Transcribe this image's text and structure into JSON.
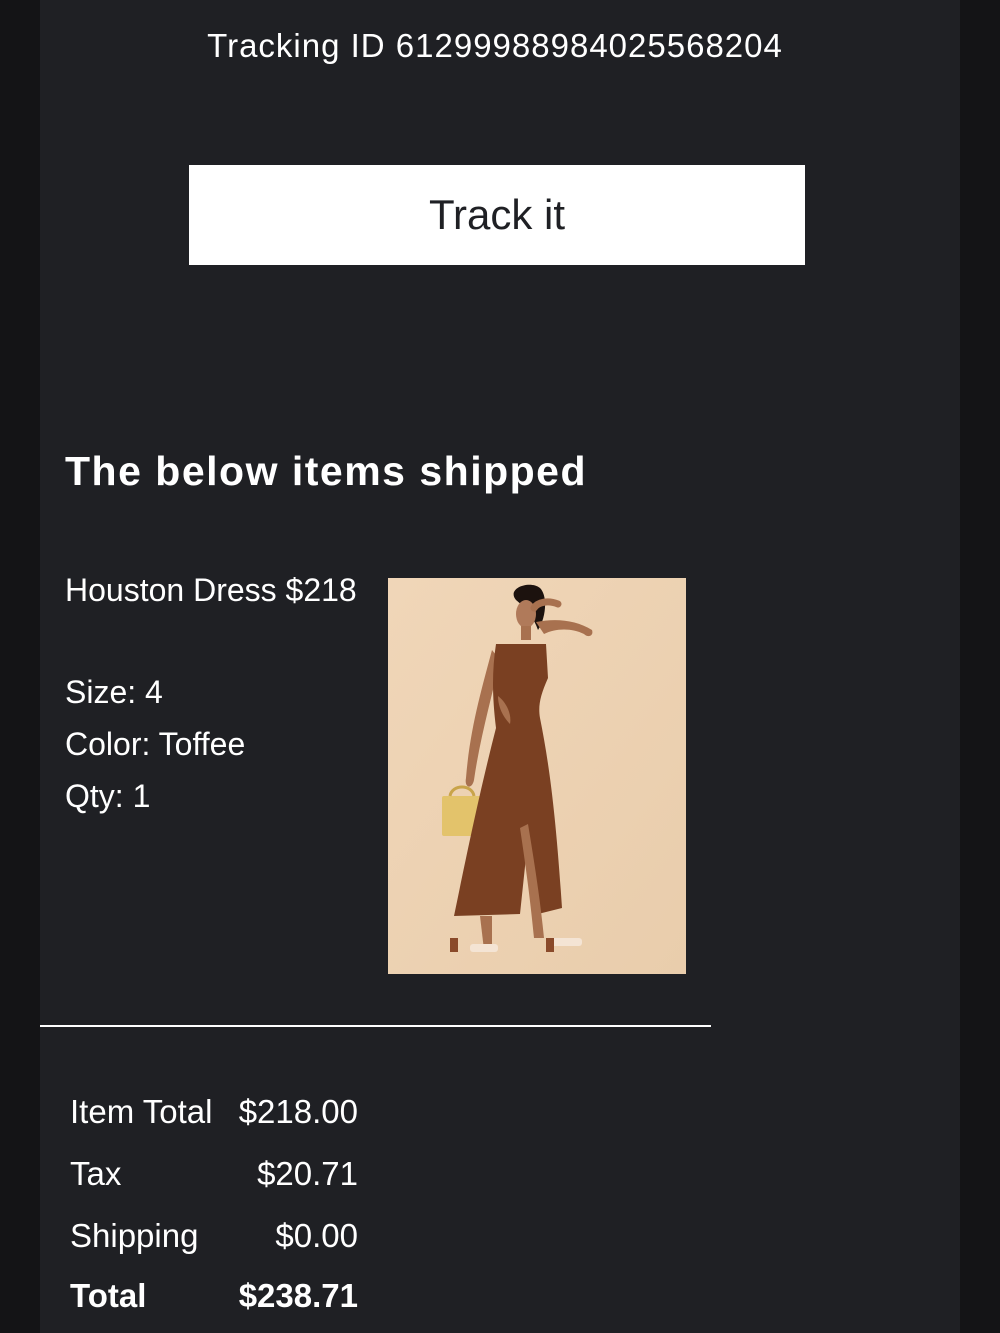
{
  "shipment": {
    "tracking_label": "Tracking ID 6129998898402556820​4",
    "track_button_label": "Track it"
  },
  "items_section": {
    "heading": "The below items shipped",
    "items": [
      {
        "title": "Houston Dress $218",
        "size": "Size: 4",
        "color": "Color: Toffee",
        "qty": "Qty: 1",
        "image": "product-photo-dress"
      }
    ]
  },
  "totals": {
    "item_total_label": "Item Total",
    "item_total_value": "$218.00",
    "tax_label": "Tax",
    "tax_value": "$20.71",
    "shipping_label": "Shipping",
    "shipping_value": "$0.00",
    "total_label": "Total",
    "total_value": "$238.71"
  },
  "colors": {
    "page_background": "#1f2024",
    "outer_background": "#141416",
    "text": "#ffffff",
    "button_background": "#ffffff",
    "dress": "#7a4022",
    "photo_background": "#ecd2b4"
  }
}
